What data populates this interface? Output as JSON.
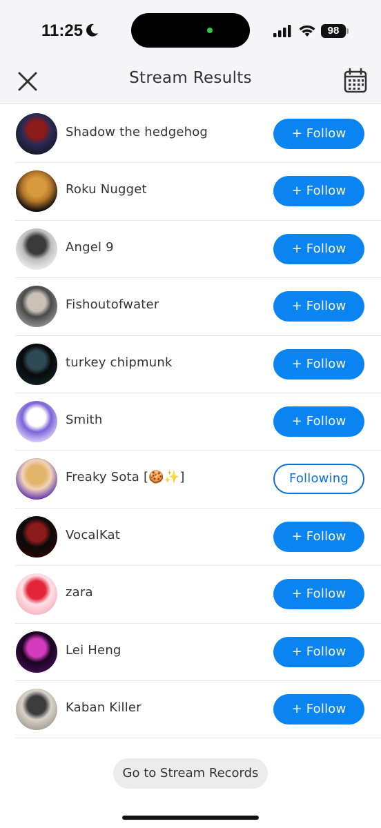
{
  "status_bar": {
    "time": "11:25",
    "battery": "98"
  },
  "header": {
    "title": "Stream Results"
  },
  "users": [
    {
      "name": "Shadow the hedgehog",
      "button": "+ Follow",
      "following": false,
      "avatar_colors": [
        "#1a1a2e",
        "#8b1a1a",
        "#2b2b55"
      ]
    },
    {
      "name": "Roku Nugget",
      "button": "+ Follow",
      "following": false,
      "avatar_colors": [
        "#0b0b0b",
        "#d79b3e",
        "#b5772a"
      ]
    },
    {
      "name": "Angel 9",
      "button": "+ Follow",
      "following": false,
      "avatar_colors": [
        "#e9e9e9",
        "#3a3a3a",
        "#bdbdbd"
      ]
    },
    {
      "name": "Fishoutofwater",
      "button": "+ Follow",
      "following": false,
      "avatar_colors": [
        "#8a8a8a",
        "#c9c1b6",
        "#4a4a4a"
      ]
    },
    {
      "name": "turkey chipmunk",
      "button": "+ Follow",
      "following": false,
      "avatar_colors": [
        "#0e1c22",
        "#2d4b55",
        "#0a0a0a"
      ]
    },
    {
      "name": "Smith",
      "button": "+ Follow",
      "following": false,
      "avatar_colors": [
        "#cfc8f5",
        "#ffffff",
        "#7b62d8"
      ]
    },
    {
      "name": "Freaky Sota [🍪✨]",
      "button": "Following",
      "following": true,
      "avatar_colors": [
        "#6a3fb0",
        "#e2b46a",
        "#f1d4b8"
      ]
    },
    {
      "name": "VocalKat",
      "button": "+ Follow",
      "following": false,
      "avatar_colors": [
        "#2a0606",
        "#8b1a1a",
        "#0b0b0b"
      ]
    },
    {
      "name": "zara",
      "button": "+ Follow",
      "following": false,
      "avatar_colors": [
        "#f7b7c4",
        "#e3253a",
        "#ffe0e6"
      ]
    },
    {
      "name": "Lei Heng",
      "button": "+ Follow",
      "following": false,
      "avatar_colors": [
        "#3b0b4a",
        "#d43bbd",
        "#1a0520"
      ]
    },
    {
      "name": "Kaban Killer",
      "button": "+ Follow",
      "following": false,
      "avatar_colors": [
        "#a9a39a",
        "#3b3b3b",
        "#d8d2c8"
      ]
    }
  ],
  "footer": {
    "records_button": "Go to Stream Records"
  },
  "colors": {
    "accent": "#0a84f0",
    "following_border": "#0a6fd6",
    "header_bg": "#f5f5f7"
  }
}
